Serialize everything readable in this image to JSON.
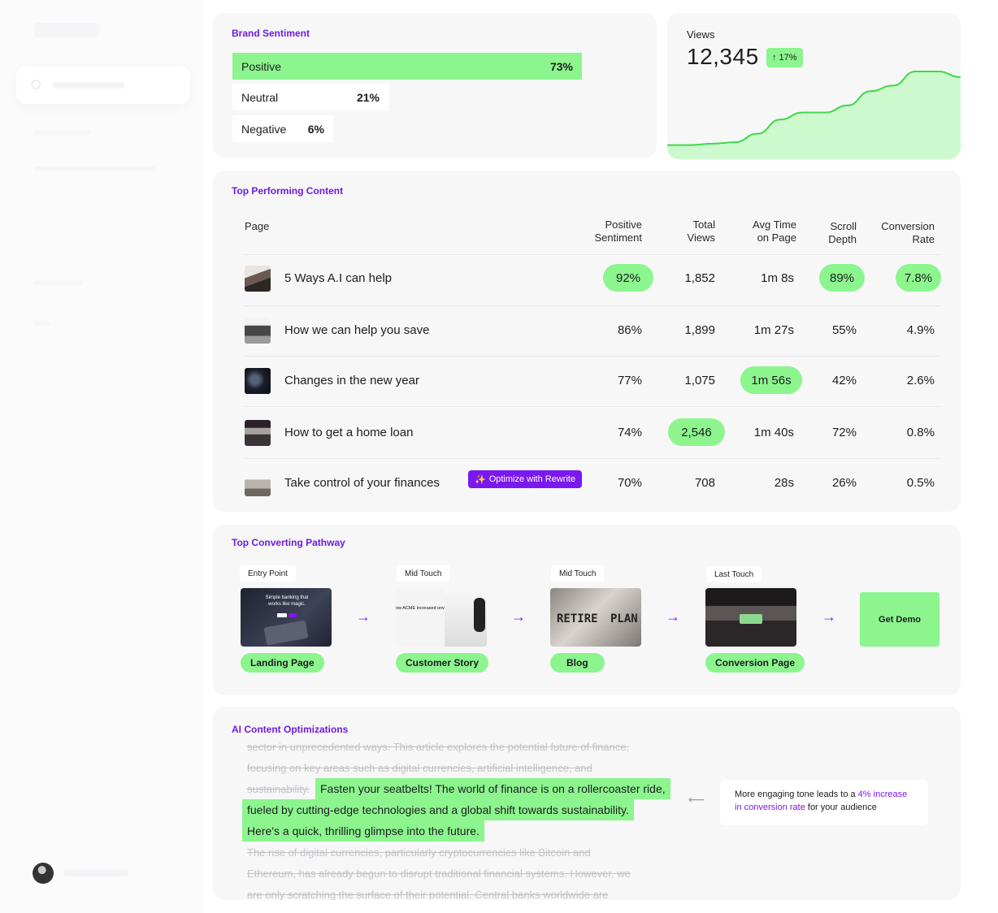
{
  "sentiment": {
    "title": "Brand Sentiment",
    "items": [
      {
        "label": "Positive",
        "pct": "73%",
        "value": 73
      },
      {
        "label": "Neutral",
        "pct": "21%",
        "value": 21
      },
      {
        "label": "Negative",
        "pct": "6%",
        "value": 6
      }
    ]
  },
  "views": {
    "label": "Views",
    "value": "12,345",
    "change": "17%"
  },
  "views_chart": {
    "type": "area",
    "values": [
      10,
      10,
      11,
      12,
      18,
      28,
      33,
      33,
      38,
      48,
      52,
      62,
      62,
      58
    ]
  },
  "top_content": {
    "title": "Top Performing Content",
    "headers": {
      "page": "Page",
      "sentiment": [
        "Positive",
        "Sentiment"
      ],
      "views": [
        "Total",
        "Views"
      ],
      "avg_time": [
        "Avg Time",
        "on Page"
      ],
      "scroll": [
        "Scroll",
        "Depth"
      ],
      "conversion": [
        "Conversion",
        "Rate"
      ]
    },
    "rows": [
      {
        "title": "5 Ways A.I can help",
        "sentiment": "92%",
        "views": "1,852",
        "time": "1m 8s",
        "scroll": "89%",
        "conversion": "7.8%"
      },
      {
        "title": "How we can help you save",
        "sentiment": "86%",
        "views": "1,899",
        "time": "1m 27s",
        "scroll": "55%",
        "conversion": "4.9%"
      },
      {
        "title": "Changes in the new year",
        "sentiment": "77%",
        "views": "1,075",
        "time": "1m 56s",
        "scroll": "42%",
        "conversion": "2.6%"
      },
      {
        "title": "How to get a home loan",
        "sentiment": "74%",
        "views": "2,546",
        "time": "1m 40s",
        "scroll": "72%",
        "conversion": "0.8%"
      },
      {
        "title": "Take control of your finances",
        "sentiment": "70%",
        "views": "708",
        "time": "28s",
        "scroll": "26%",
        "conversion": "0.5%"
      }
    ],
    "rewrite_label": "Optimize with Rewrite",
    "accent_color": "#7a18f0",
    "highlight_color": "#8cf58e"
  },
  "pathway": {
    "title": "Top Converting Pathway",
    "stages": [
      {
        "tag": "Entry Point",
        "pill": "Landing Page",
        "image_text": "Simple banking that works like magic."
      },
      {
        "tag": "Mid Touch",
        "pill": "Customer Story",
        "image_text": "ow ACME increased onversion rates"
      },
      {
        "tag": "Mid Touch",
        "pill": "Blog",
        "image_text": [
          "RETIRE",
          "PLAN"
        ]
      },
      {
        "tag": "Last Touch",
        "pill": "Conversion Page"
      }
    ],
    "cta": "Get Demo"
  },
  "optimizations": {
    "title": "AI Content Optimizations",
    "strike_before": [
      "sector in unprecedented ways. This article explores the potential future of finance,",
      "focusing on key areas such as digital currencies, artificial intelligence, and",
      "sustainability."
    ],
    "highlight": [
      "Fasten your seatbelts! The world of finance is on a rollercoaster ride,",
      "fueled by cutting-edge technologies and a global shift towards sustainability.",
      "Here's a quick, thrilling glimpse into the future."
    ],
    "strike_after": [
      "The rise of digital currencies, particularly cryptocurrencies like Bitcoin and",
      "Ethereum, has already begun to disrupt traditional financial systems. However, we",
      "are only scratching the surface of their potential. Central banks worldwide are"
    ],
    "hint": {
      "prefix": "More engaging tone leads to a ",
      "accent1": "4% increase",
      "accent2": "in conversion rate",
      "suffix": " for your audience"
    }
  }
}
